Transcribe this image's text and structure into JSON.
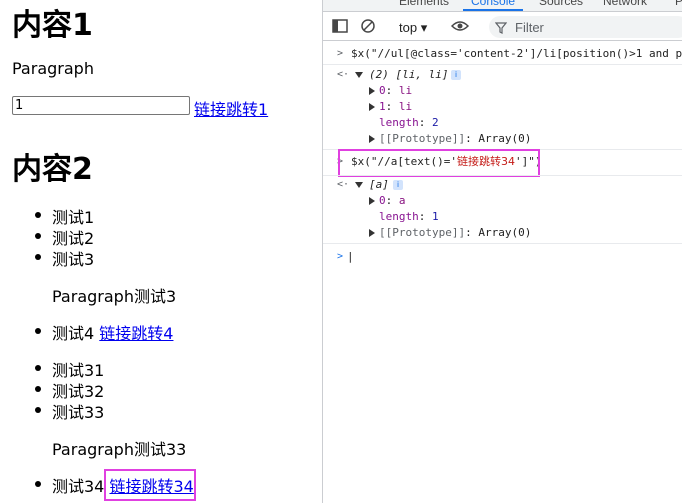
{
  "page": {
    "section1": {
      "heading": "内容1",
      "paragraph": "Paragraph",
      "input_value": "1",
      "link": "链接跳转1"
    },
    "section2": {
      "heading": "内容2",
      "list1": [
        "测试1",
        "测试2",
        "测试3"
      ],
      "para1": "Paragraph测试3",
      "item4_text": "测试4",
      "item4_link": "链接跳转4",
      "list2": [
        "测试31",
        "测试32",
        "测试33"
      ],
      "para2": "Paragraph测试33",
      "item34_text": "测试34",
      "item34_link": "链接跳转34"
    }
  },
  "devtools": {
    "tabs": [
      "Elements",
      "Console",
      "Sources",
      "Network",
      "Pe"
    ],
    "active_tab": "Console",
    "context": "top",
    "filter_placeholder": "Filter",
    "console": {
      "cmd1": "$x(\"//ul[@class='content-2']/li[position()>1 and positi",
      "res1_summary": "(2) [li, li]",
      "res1_items": [
        {
          "key": "0",
          "value": "li"
        },
        {
          "key": "1",
          "value": "li"
        }
      ],
      "res1_length_key": "length",
      "res1_length_val": "2",
      "res1_proto_key": "[[Prototype]]",
      "res1_proto_val": "Array(0)",
      "cmd2_prefix": "$x(\"//a[text()='",
      "cmd2_str": "链接跳转34",
      "cmd2_suffix": "']\")",
      "res2_summary": "[a]",
      "res2_items": [
        {
          "key": "0",
          "value": "a"
        }
      ],
      "res2_length_key": "length",
      "res2_length_val": "1",
      "res2_proto_key": "[[Prototype]]",
      "res2_proto_val": "Array(0)",
      "prompt_caret": "|"
    }
  },
  "colors": {
    "highlight": "#e040e0",
    "link": "#0000ee",
    "accent": "#1a73e8"
  }
}
